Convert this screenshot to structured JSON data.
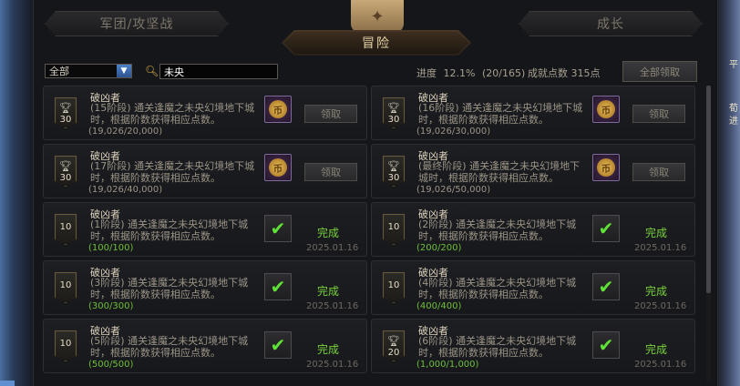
{
  "tabs": {
    "left": "军团/攻坚战",
    "center": "冒险",
    "right": "成长"
  },
  "emblem_icon": "compass-scroll-icon",
  "filter": {
    "selected": "全部",
    "search_value": "未央"
  },
  "progress": {
    "label": "进度",
    "percent": "12.1%",
    "fraction": "(20/165)"
  },
  "points": {
    "label": "成就点数",
    "value": "315点"
  },
  "claim_all_label": "全部领取",
  "side_text": {
    "right_top": "平",
    "right_mid": "荀",
    "right_mid2": "进",
    "right_bot": ""
  },
  "cards": [
    {
      "title": "破凶者",
      "desc": "(15阶段) 通关逢魔之未央幻境地下城时，根据阶数获得相应点数。",
      "progress": "(19,026/20,000)",
      "badge": "30",
      "trophy": true,
      "state": "claim",
      "action": "领取"
    },
    {
      "title": "破凶者",
      "desc": "(16阶段) 通关逢魔之未央幻境地下城时，根据阶数获得相应点数。",
      "progress": "(19,026/30,000)",
      "badge": "30",
      "trophy": true,
      "state": "claim",
      "action": "领取"
    },
    {
      "title": "破凶者",
      "desc": "(17阶段) 通关逢魔之未央幻境地下城时，根据阶数获得相应点数。",
      "progress": "(19,026/40,000)",
      "badge": "30",
      "trophy": true,
      "state": "claim",
      "action": "领取"
    },
    {
      "title": "破凶者",
      "desc": "(最终阶段) 通关逢魔之未央幻境地下城时，根据阶数获得相应点数。",
      "progress": "(19,026/50,000)",
      "badge": "30",
      "trophy": true,
      "state": "claim",
      "action": "领取"
    },
    {
      "title": "破凶者",
      "desc": "(1阶段) 通关逢魔之未央幻境地下城时，根据阶数获得相应点数。",
      "progress": "(100/100)",
      "badge": "10",
      "trophy": false,
      "state": "done",
      "action": "完成",
      "date": "2025.01.16"
    },
    {
      "title": "破凶者",
      "desc": "(2阶段) 通关逢魔之未央幻境地下城时，根据阶数获得相应点数。",
      "progress": "(200/200)",
      "badge": "10",
      "trophy": false,
      "state": "done",
      "action": "完成",
      "date": "2025.01.16"
    },
    {
      "title": "破凶者",
      "desc": "(3阶段) 通关逢魔之未央幻境地下城时，根据阶数获得相应点数。",
      "progress": "(300/300)",
      "badge": "10",
      "trophy": false,
      "state": "done",
      "action": "完成",
      "date": "2025.01.16"
    },
    {
      "title": "破凶者",
      "desc": "(4阶段) 通关逢魔之未央幻境地下城时，根据阶数获得相应点数。",
      "progress": "(400/400)",
      "badge": "10",
      "trophy": false,
      "state": "done",
      "action": "完成",
      "date": "2025.01.16"
    },
    {
      "title": "破凶者",
      "desc": "(5阶段) 通关逢魔之未央幻境地下城时，根据阶数获得相应点数。",
      "progress": "(500/500)",
      "badge": "10",
      "trophy": false,
      "state": "done",
      "action": "完成",
      "date": "2025.01.16"
    },
    {
      "title": "破凶者",
      "desc": "(6阶段) 通关逢魔之未央幻境地下城时，根据阶数获得相应点数。",
      "progress": "(1,000/1,000)",
      "badge": "20",
      "trophy": true,
      "state": "done",
      "action": "完成",
      "date": "2025.01.16"
    }
  ]
}
